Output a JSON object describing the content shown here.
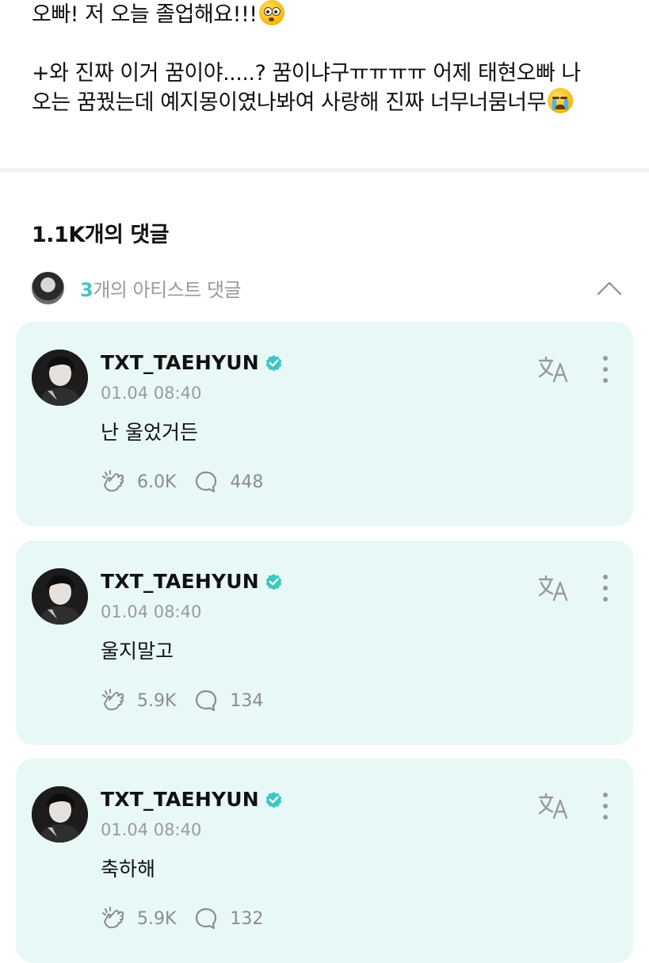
{
  "post": {
    "line1": "오빠! 저 오늘 졸업해요!!!",
    "line2": "+와 진짜 이거 꿈이야.....? 꿈이냐구ㅠㅠㅠㅠ 어제 태현오빠 나",
    "line3": "오는 꿈꿨는데 예지몽이였나봐여 사랑해 진짜 너무너뭄너무",
    "line1_emoji": "flushed-face-emoji",
    "line3_emoji": "loudly-crying-face-emoji"
  },
  "comments_header": {
    "count_label": "1.1K개의 댓글"
  },
  "artist_comments": {
    "count": "3",
    "label": "개의 아티스트 댓글",
    "toggle_icon": "chevron-up-icon"
  },
  "accent_color": "#3ec7c0",
  "card_background": "#e8f8f6",
  "comments": [
    {
      "author": "TXT_TAEHYUN",
      "time": "01.04 08:40",
      "text": "난 울었거든",
      "likes": "6.0K",
      "replies": "448"
    },
    {
      "author": "TXT_TAEHYUN",
      "time": "01.04 08:40",
      "text": "울지말고",
      "likes": "5.9K",
      "replies": "134"
    },
    {
      "author": "TXT_TAEHYUN",
      "time": "01.04 08:40",
      "text": "축하해",
      "likes": "5.9K",
      "replies": "132"
    }
  ]
}
